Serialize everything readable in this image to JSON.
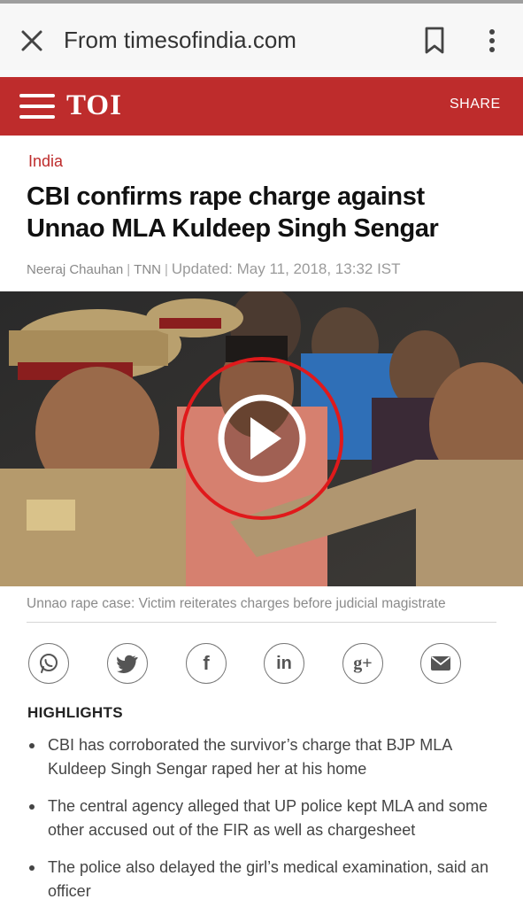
{
  "browser": {
    "url_title": "From timesofindia.com",
    "close_icon": "close-icon",
    "bookmark_icon": "bookmark-icon",
    "menu_icon": "kebab-menu-icon"
  },
  "site_header": {
    "logo": "TOI",
    "share_label": "SHARE",
    "brand_color": "#be2c2c"
  },
  "article": {
    "section": "India",
    "headline": "CBI confirms rape charge against Unnao MLA Kuldeep Singh Sengar",
    "author": "Neeraj Chauhan",
    "agency": "TNN",
    "updated": "Updated: May 11, 2018, 13:32 IST",
    "video_caption": "Unnao rape case: Victim reiterates charges before judicial magistrate",
    "play_icon": "play-icon"
  },
  "share_buttons": [
    {
      "icon": "whatsapp-icon"
    },
    {
      "icon": "twitter-icon"
    },
    {
      "icon": "facebook-icon",
      "glyph": "f"
    },
    {
      "icon": "linkedin-icon",
      "glyph": "in"
    },
    {
      "icon": "google-plus-icon",
      "glyph": "g+"
    },
    {
      "icon": "email-icon"
    }
  ],
  "highlights": {
    "title": "HIGHLIGHTS",
    "items": [
      "CBI has corroborated the survivor’s charge that BJP MLA Kuldeep Singh Sengar raped her at his home",
      "The central agency alleged that UP police kept MLA and some other accused out of the FIR as well as chargesheet",
      "The police also delayed the girl’s medical examination, said an officer"
    ]
  }
}
